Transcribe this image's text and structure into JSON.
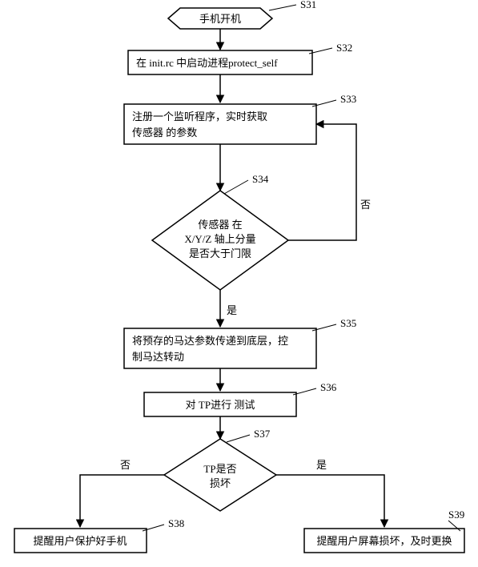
{
  "nodes": {
    "s31": {
      "label": "S31",
      "text": "手机开机"
    },
    "s32": {
      "label": "S32",
      "text": "在 init.rc  中启动进程protect_self"
    },
    "s33": {
      "label": "S33",
      "line1": "注册一个监听程序，实时获取",
      "line2": "传感器  的参数"
    },
    "s34": {
      "label": "S34",
      "line1": "传感器        在",
      "line2": "X/Y/Z  轴上分量",
      "line3": "是否大于门限"
    },
    "s35": {
      "label": "S35",
      "line1": "将预存的马达参数传递到底层，控",
      "line2": "制马达转动"
    },
    "s36": {
      "label": "S36",
      "text": "对 TP进行 测试"
    },
    "s37": {
      "label": "S37",
      "line1": "TP是否",
      "line2": "损坏"
    },
    "s38": {
      "label": "S38",
      "text": "提醒用户保护好手机"
    },
    "s39": {
      "label": "S39",
      "text": "提醒用户屏幕损坏，及时更换"
    }
  },
  "edges": {
    "yes": "是",
    "no": "否"
  }
}
